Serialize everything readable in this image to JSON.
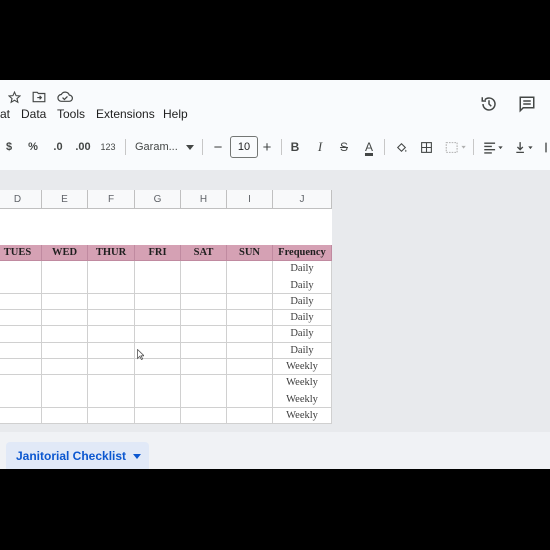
{
  "menu": {
    "items": [
      "at",
      "Data",
      "Tools",
      "Extensions",
      "Help"
    ]
  },
  "icons": {
    "star": "star-icon",
    "folder": "move-folder-icon",
    "cloud": "cloud-status-icon",
    "history": "version-history-icon",
    "comments": "comments-icon"
  },
  "toolbar": {
    "currency": "$",
    "percent": "%",
    "decrease_decimal": ".0",
    "increase_decimal": ".00",
    "number_format": "123",
    "font": "Garam...",
    "font_size": "10",
    "minus": "−",
    "plus": "+",
    "bold": "B",
    "italic": "I",
    "strike": "S",
    "text_color": "A"
  },
  "columns": [
    "D",
    "E",
    "F",
    "G",
    "H",
    "I",
    "J"
  ],
  "table": {
    "headers": [
      "TUES",
      "WED",
      "THUR",
      "FRI",
      "SAT",
      "SUN",
      "Frequency"
    ],
    "frequency": [
      "Daily",
      "Daily",
      "Daily",
      "Daily",
      "Daily",
      "Daily",
      "Weekly",
      "Weekly",
      "Weekly",
      "Weekly"
    ]
  },
  "sheet_tab": {
    "label": "Janitorial Checklist"
  },
  "colors": {
    "header_fill": "#d5a1b4",
    "tab_text": "#0b57d0",
    "tab_fill": "#e1e9f7"
  }
}
